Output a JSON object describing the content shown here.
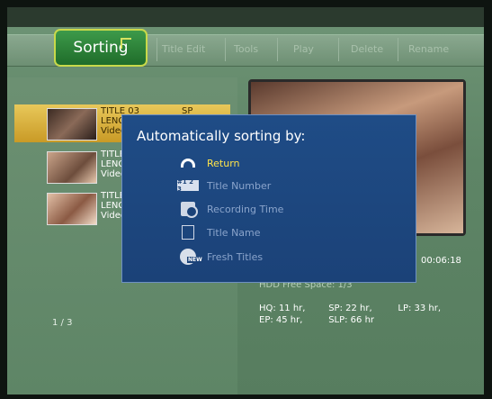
{
  "tabs": {
    "active": "Sorting",
    "items": [
      "Title Edit",
      "Tools",
      "Play",
      "Delete",
      "Rename"
    ]
  },
  "titles": [
    {
      "line1": "TITLE 03",
      "line2": "LENG",
      "line3": "Video",
      "quality": "SP",
      "selected": true
    },
    {
      "line1": "TITLE",
      "line2": "LENG",
      "line3": "Video"
    },
    {
      "line1": "TITLE",
      "line2": "LENG",
      "line3": "Video"
    }
  ],
  "pager": "1 / 3",
  "duration": "00:06:18",
  "free_space": "HDD Free Space: 1/3",
  "stats": {
    "hq": "HQ: 11 hr,",
    "sp": "SP: 22 hr,",
    "lp": "LP: 33 hr,",
    "ep": "EP: 45 hr,",
    "slp": "SLP: 66 hr"
  },
  "dialog": {
    "title": "Automatically sorting by:",
    "options": [
      {
        "label": "Return",
        "icon": "return-icon",
        "active": true
      },
      {
        "label": "Title Number",
        "icon": "title-number-icon"
      },
      {
        "label": "Recording Time",
        "icon": "recording-time-icon"
      },
      {
        "label": "Title Name",
        "icon": "title-name-icon"
      },
      {
        "label": "Fresh Titles",
        "icon": "fresh-titles-icon"
      }
    ]
  },
  "colors": {
    "dialog_bg": "#1f4c86",
    "active_option": "#ffe44a",
    "selected_row": "#e8c85a",
    "active_tab": "#2c8a38"
  }
}
